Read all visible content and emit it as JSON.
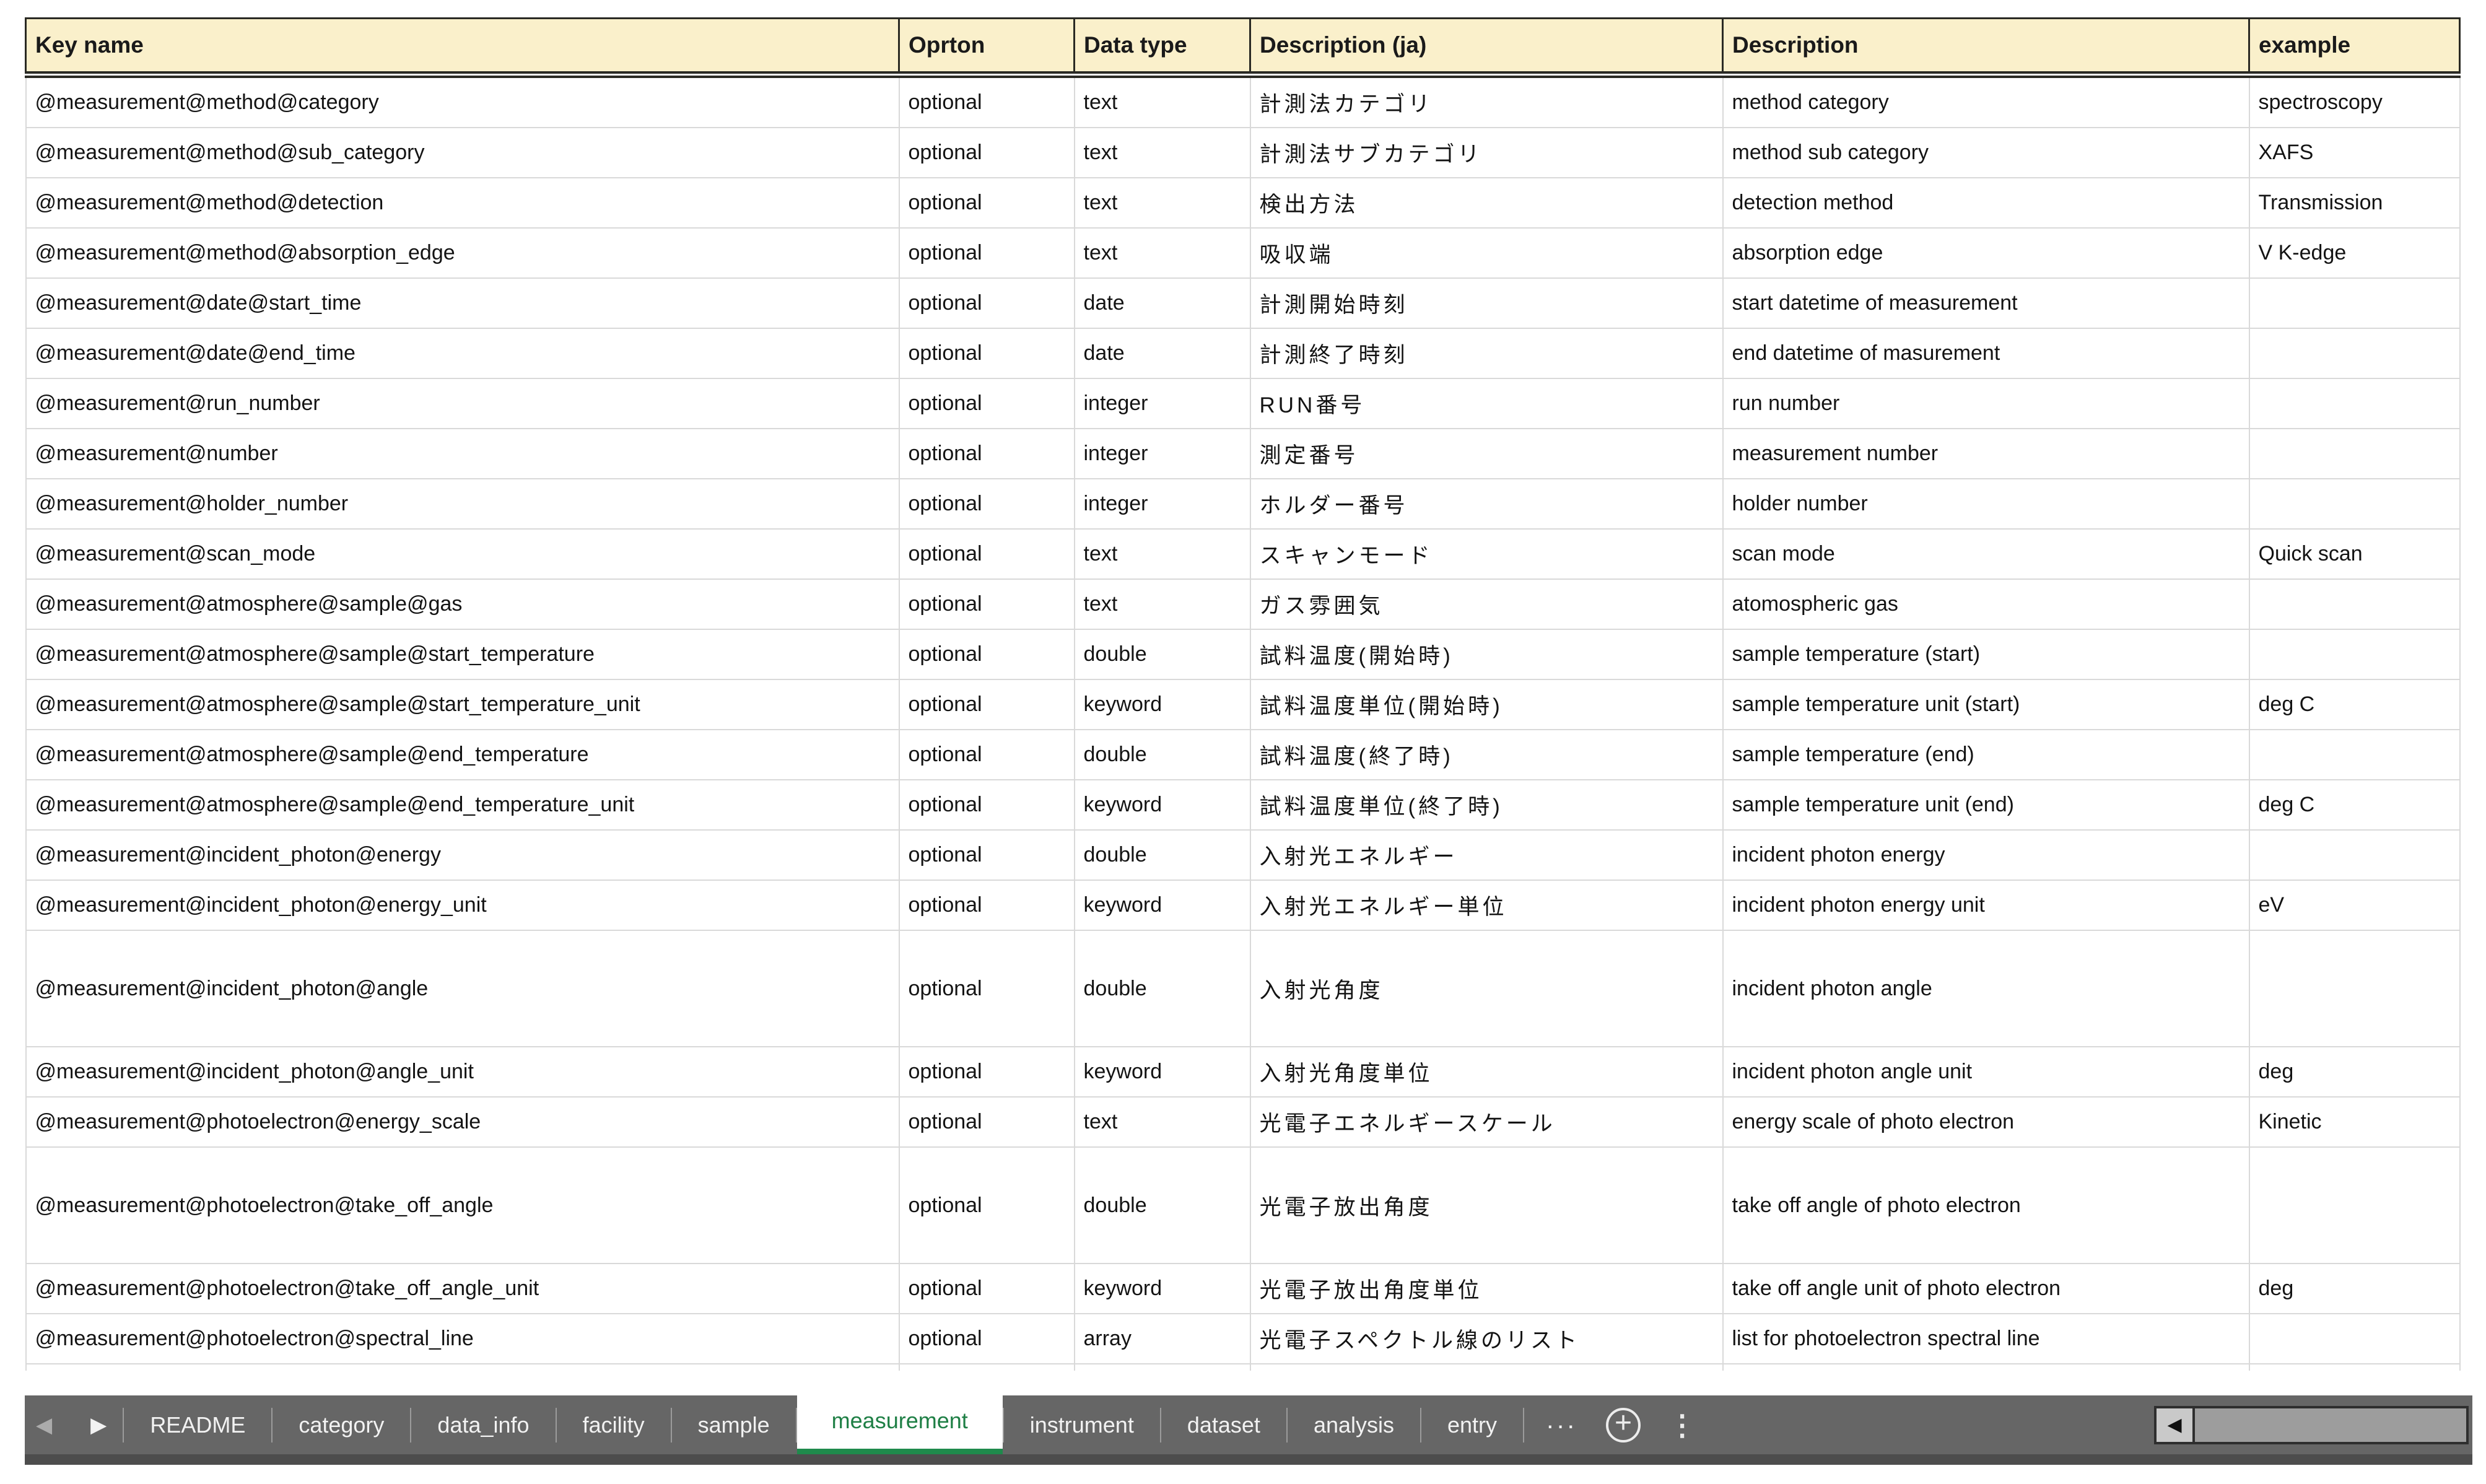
{
  "table": {
    "columns": [
      {
        "key": "key_name",
        "label": "Key name"
      },
      {
        "key": "option",
        "label": "Oprton"
      },
      {
        "key": "data_type",
        "label": "Data type"
      },
      {
        "key": "description_ja",
        "label": "Description (ja)"
      },
      {
        "key": "description",
        "label": "Description"
      },
      {
        "key": "example",
        "label": "example"
      }
    ],
    "rows": [
      {
        "key_name": "@measurement@method@category",
        "option": "optional",
        "data_type": "text",
        "description_ja": "計測法カテゴリ",
        "description": "method category",
        "example": "spectroscopy"
      },
      {
        "key_name": "@measurement@method@sub_category",
        "option": "optional",
        "data_type": "text",
        "description_ja": "計測法サブカテゴリ",
        "description": "method sub category",
        "example": "XAFS"
      },
      {
        "key_name": "@measurement@method@detection",
        "option": "optional",
        "data_type": "text",
        "description_ja": "検出方法",
        "description": "detection method",
        "example": "Transmission"
      },
      {
        "key_name": "@measurement@method@absorption_edge",
        "option": "optional",
        "data_type": "text",
        "description_ja": "吸収端",
        "description": "absorption edge",
        "example": "V K-edge"
      },
      {
        "key_name": "@measurement@date@start_time",
        "option": "optional",
        "data_type": "date",
        "description_ja": "計測開始時刻",
        "description": "start datetime of measurement",
        "example": ""
      },
      {
        "key_name": "@measurement@date@end_time",
        "option": "optional",
        "data_type": "date",
        "description_ja": "計測終了時刻",
        "description": "end datetime of masurement",
        "example": ""
      },
      {
        "key_name": "@measurement@run_number",
        "option": "optional",
        "data_type": "integer",
        "description_ja": "RUN番号",
        "description": "run number",
        "example": ""
      },
      {
        "key_name": "@measurement@number",
        "option": "optional",
        "data_type": "integer",
        "description_ja": "測定番号",
        "description": "measurement number",
        "example": ""
      },
      {
        "key_name": "@measurement@holder_number",
        "option": "optional",
        "data_type": "integer",
        "description_ja": "ホルダー番号",
        "description": "holder number",
        "example": ""
      },
      {
        "key_name": "@measurement@scan_mode",
        "option": "optional",
        "data_type": "text",
        "description_ja": "スキャンモード",
        "description": "scan mode",
        "example": "Quick scan"
      },
      {
        "key_name": "@measurement@atmosphere@sample@gas",
        "option": "optional",
        "data_type": "text",
        "description_ja": "ガス雰囲気",
        "description": "atomospheric gas",
        "example": ""
      },
      {
        "key_name": "@measurement@atmosphere@sample@start_temperature",
        "option": "optional",
        "data_type": "double",
        "description_ja": "試料温度(開始時)",
        "description": "sample temperature (start)",
        "example": ""
      },
      {
        "key_name": "@measurement@atmosphere@sample@start_temperature_unit",
        "option": "optional",
        "data_type": "keyword",
        "description_ja": "試料温度単位(開始時)",
        "description": "sample temperature unit (start)",
        "example": "deg C"
      },
      {
        "key_name": "@measurement@atmosphere@sample@end_temperature",
        "option": "optional",
        "data_type": "double",
        "description_ja": "試料温度(終了時)",
        "description": "sample temperature (end)",
        "example": ""
      },
      {
        "key_name": "@measurement@atmosphere@sample@end_temperature_unit",
        "option": "optional",
        "data_type": "keyword",
        "description_ja": "試料温度単位(終了時)",
        "description": "sample temperature unit (end)",
        "example": "deg C"
      },
      {
        "key_name": "@measurement@incident_photon@energy",
        "option": "optional",
        "data_type": "double",
        "description_ja": "入射光エネルギー",
        "description": "incident photon energy",
        "example": ""
      },
      {
        "key_name": "@measurement@incident_photon@energy_unit",
        "option": "optional",
        "data_type": "keyword",
        "description_ja": "入射光エネルギー単位",
        "description": "incident photon energy unit",
        "example": "eV"
      },
      {
        "key_name": "@measurement@incident_photon@angle",
        "option": "optional",
        "data_type": "double",
        "description_ja": "入射光角度",
        "description": "incident photon angle",
        "example": ""
      },
      {
        "key_name": "@measurement@incident_photon@angle_unit",
        "option": "optional",
        "data_type": "keyword",
        "description_ja": "入射光角度単位",
        "description": "incident photon angle unit",
        "example": "deg"
      },
      {
        "key_name": "@measurement@photoelectron@energy_scale",
        "option": "optional",
        "data_type": "text",
        "description_ja": "光電子エネルギースケール",
        "description": "energy scale of photo electron",
        "example": "Kinetic"
      },
      {
        "key_name": "@measurement@photoelectron@take_off_angle",
        "option": "optional",
        "data_type": "double",
        "description_ja": "光電子放出角度",
        "description": "take off angle of photo electron",
        "example": ""
      },
      {
        "key_name": "@measurement@photoelectron@take_off_angle_unit",
        "option": "optional",
        "data_type": "keyword",
        "description_ja": "光電子放出角度単位",
        "description": "take off angle unit of photo electron",
        "example": "deg"
      },
      {
        "key_name": "@measurement@photoelectron@spectral_line",
        "option": "optional",
        "data_type": "array",
        "description_ja": "光電子スペクトル線のリスト",
        "description": "list for photoelectron spectral line",
        "example": ""
      }
    ]
  },
  "sheet_tabs": {
    "scroll_left_icon": "◀",
    "scroll_right_icon": "▶",
    "tabs": [
      "README",
      "category",
      "data_info",
      "facility",
      "sample",
      "measurement",
      "instrument",
      "dataset",
      "analysis",
      "entry"
    ],
    "active_tab": "measurement",
    "overflow_label": "...",
    "add_sheet_label": "+",
    "more_label": "⋮"
  },
  "scrollbar": {
    "left_arrow_icon": "◀"
  },
  "colors": {
    "header_bg": "#FAF0CB",
    "header_border": "#2A2A24",
    "grid_line": "#D9D9D9",
    "body_text": "#131313",
    "tab_bar_bg": "#666666",
    "tab_bar_text": "#F2F2F2",
    "tab_separator": "#9B9B9B",
    "active_tab_bg": "#FFFFFF",
    "active_tab_text": "#1E7F45",
    "active_tab_underline": "#1F8A4C",
    "below_strip": "#4D4D4D",
    "scrollbar_border": "#2E2E2E",
    "scrollbar_button_bg": "#C9C9C9",
    "scrollbar_thumb": "#9D9D9D",
    "scrollbar_arrow": "#111111",
    "nav_arrow_dim": "#ABABAB"
  }
}
